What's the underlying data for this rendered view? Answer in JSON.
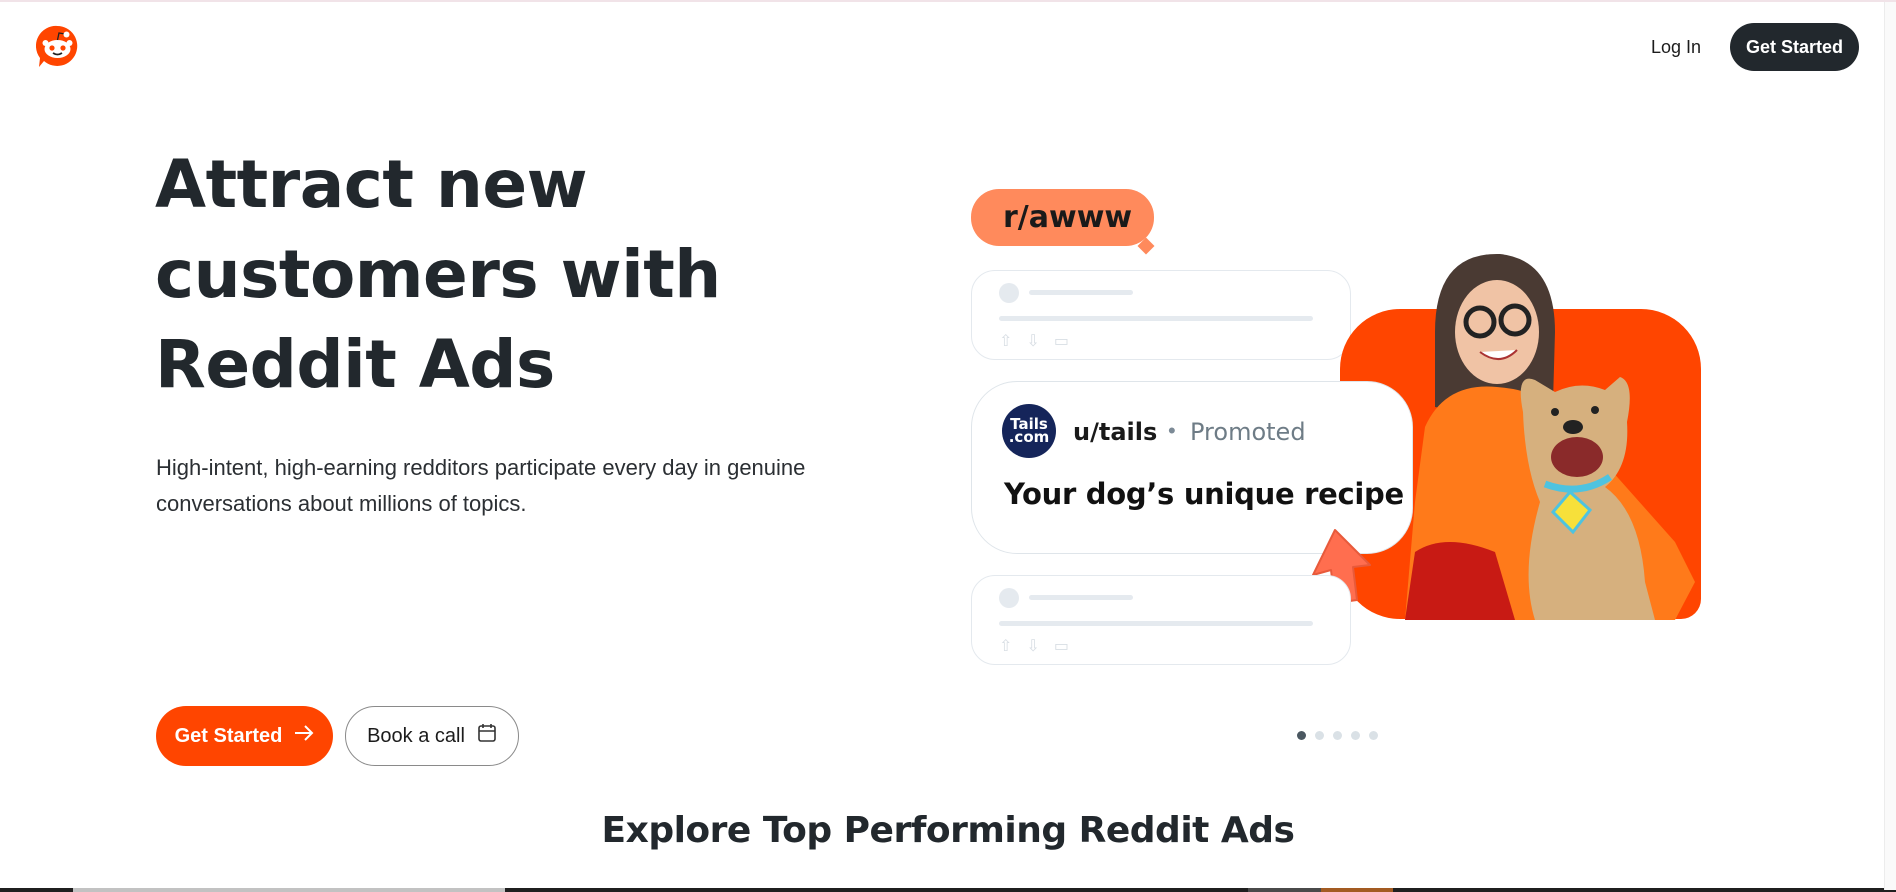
{
  "header": {
    "logo_alt": "Reddit",
    "login_label": "Log In",
    "get_started_label": "Get Started"
  },
  "hero": {
    "title_line1": "Attract new",
    "title_line2": "customers with",
    "title_line3": "Reddit Ads",
    "subtitle": "High-intent, high-earning redditors participate every day in genuine conversations about millions of topics.",
    "cta_primary_label": "Get Started",
    "cta_primary_icon": "arrow-right-icon",
    "cta_secondary_label": "Book a call",
    "cta_secondary_icon": "calendar-icon"
  },
  "illustration": {
    "subreddit": "r/awww",
    "ad": {
      "avatar_line1": "Tails",
      "avatar_line2": ".com",
      "username": "u/tails",
      "separator": "•",
      "tag": "Promoted",
      "headline": "Your dog’s unique recipe"
    },
    "vote_icons": [
      "upvote-icon",
      "downvote-icon",
      "comment-icon"
    ]
  },
  "carousel": {
    "total": 5,
    "active_index": 0
  },
  "section": {
    "title": "Explore Top Performing Reddit Ads"
  },
  "colors": {
    "brand": "#ff4500",
    "dark": "#22282d",
    "bubble": "#ff8a5c"
  }
}
